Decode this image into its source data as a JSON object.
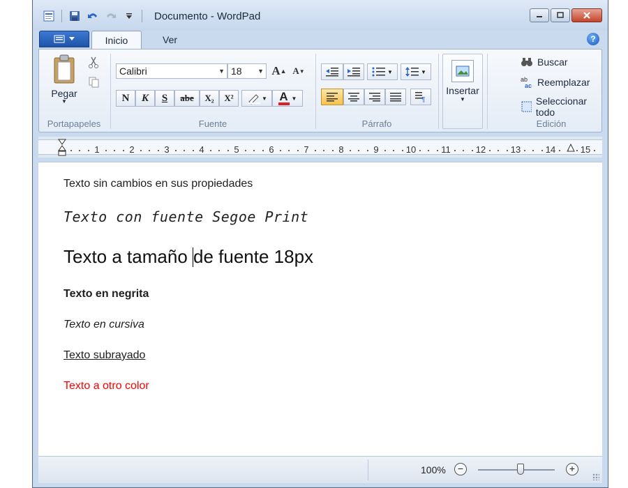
{
  "window": {
    "title": "Documento - WordPad"
  },
  "tabs": {
    "active": "Inicio",
    "other": "Ver"
  },
  "ribbon": {
    "clipboard": {
      "label": "Portapapeles",
      "paste": "Pegar"
    },
    "font": {
      "label": "Fuente",
      "family": "Calibri",
      "size": "18",
      "bold": "N",
      "italic": "K",
      "underline": "S",
      "strike": "abe",
      "subscript": "X₂",
      "superscript": "X²",
      "text_color": "#e02020"
    },
    "paragraph": {
      "label": "Párrafo"
    },
    "insert": {
      "label": "Insertar"
    },
    "editing": {
      "label": "Edición",
      "find": "Buscar",
      "replace": "Reemplazar",
      "select_all": "Seleccionar todo"
    }
  },
  "ruler": {
    "numbers": [
      "1",
      "2",
      "3",
      "4",
      "5",
      "6",
      "7",
      "8",
      "9",
      "10",
      "11",
      "12",
      "13",
      "14",
      "15"
    ]
  },
  "document": {
    "lines": [
      "Texto sin cambios en sus propiedades",
      "Texto con fuente Segoe Print",
      "Texto a tamaño ",
      "de fuente 18px",
      "Texto en negrita",
      "Texto en cursiva",
      "Texto subrayado",
      "Texto a otro color"
    ],
    "colored_line_color": "#ff0000"
  },
  "status": {
    "zoom": "100%",
    "zoom_level": 0.55
  }
}
